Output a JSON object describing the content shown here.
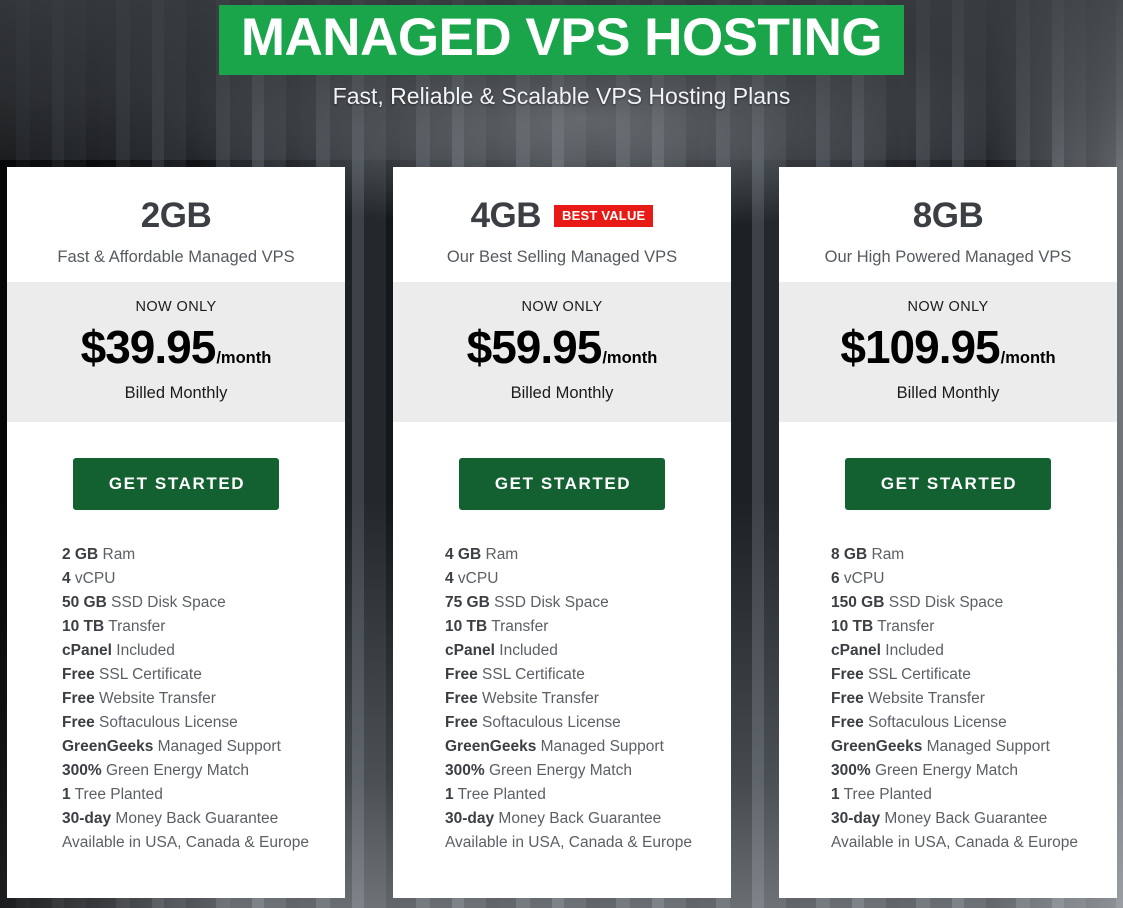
{
  "header": {
    "title": "MANAGED VPS HOSTING",
    "subtitle": "Fast, Reliable & Scalable VPS Hosting Plans",
    "banner_color": "#1aa54b"
  },
  "labels": {
    "now_only": "NOW ONLY",
    "billed": "Billed Monthly",
    "cta": "GET STARTED",
    "period": "/month",
    "badge": "BEST VALUE",
    "badge_color": "#e81a15",
    "cta_color": "#136130"
  },
  "plans": [
    {
      "name": "2GB",
      "tagline": "Fast & Affordable Managed VPS",
      "badge": "",
      "price": "$39.95",
      "period": "/month",
      "now_only": "NOW ONLY",
      "billed": "Billed Monthly",
      "cta": "GET STARTED",
      "features": [
        {
          "bold": "2 GB",
          "rest": " Ram"
        },
        {
          "bold": "4",
          "rest": " vCPU"
        },
        {
          "bold": "50 GB",
          "rest": " SSD Disk Space"
        },
        {
          "bold": "10 TB",
          "rest": " Transfer"
        },
        {
          "bold": "cPanel",
          "rest": " Included"
        },
        {
          "bold": "Free",
          "rest": " SSL Certificate"
        },
        {
          "bold": "Free",
          "rest": " Website Transfer"
        },
        {
          "bold": "Free",
          "rest": " Softaculous License"
        },
        {
          "bold": "GreenGeeks",
          "rest": " Managed Support"
        },
        {
          "bold": "300%",
          "rest": " Green Energy Match"
        },
        {
          "bold": "1",
          "rest": " Tree Planted"
        },
        {
          "bold": "30-day",
          "rest": " Money Back Guarantee"
        },
        {
          "bold": "",
          "rest": "Available in USA, Canada & Europe"
        }
      ]
    },
    {
      "name": "4GB",
      "tagline": "Our Best Selling Managed VPS",
      "badge": "BEST VALUE",
      "price": "$59.95",
      "period": "/month",
      "now_only": "NOW ONLY",
      "billed": "Billed Monthly",
      "cta": "GET STARTED",
      "features": [
        {
          "bold": "4 GB",
          "rest": " Ram"
        },
        {
          "bold": "4",
          "rest": " vCPU"
        },
        {
          "bold": "75 GB",
          "rest": " SSD Disk Space"
        },
        {
          "bold": "10 TB",
          "rest": " Transfer"
        },
        {
          "bold": "cPanel",
          "rest": " Included"
        },
        {
          "bold": "Free",
          "rest": " SSL Certificate"
        },
        {
          "bold": "Free",
          "rest": " Website Transfer"
        },
        {
          "bold": "Free",
          "rest": " Softaculous License"
        },
        {
          "bold": "GreenGeeks",
          "rest": " Managed Support"
        },
        {
          "bold": "300%",
          "rest": " Green Energy Match"
        },
        {
          "bold": "1",
          "rest": " Tree Planted"
        },
        {
          "bold": "30-day",
          "rest": " Money Back Guarantee"
        },
        {
          "bold": "",
          "rest": "Available in USA, Canada & Europe"
        }
      ]
    },
    {
      "name": "8GB",
      "tagline": "Our High Powered Managed VPS",
      "badge": "",
      "price": "$109.95",
      "period": "/month",
      "now_only": "NOW ONLY",
      "billed": "Billed Monthly",
      "cta": "GET STARTED",
      "features": [
        {
          "bold": "8 GB",
          "rest": " Ram"
        },
        {
          "bold": "6",
          "rest": " vCPU"
        },
        {
          "bold": "150 GB",
          "rest": " SSD Disk Space"
        },
        {
          "bold": "10 TB",
          "rest": " Transfer"
        },
        {
          "bold": "cPanel",
          "rest": " Included"
        },
        {
          "bold": "Free",
          "rest": " SSL Certificate"
        },
        {
          "bold": "Free",
          "rest": " Website Transfer"
        },
        {
          "bold": "Free",
          "rest": " Softaculous License"
        },
        {
          "bold": "GreenGeeks",
          "rest": " Managed Support"
        },
        {
          "bold": "300%",
          "rest": " Green Energy Match"
        },
        {
          "bold": "1",
          "rest": " Tree Planted"
        },
        {
          "bold": "30-day",
          "rest": " Money Back Guarantee"
        },
        {
          "bold": "",
          "rest": "Available in USA, Canada & Europe"
        }
      ]
    }
  ]
}
